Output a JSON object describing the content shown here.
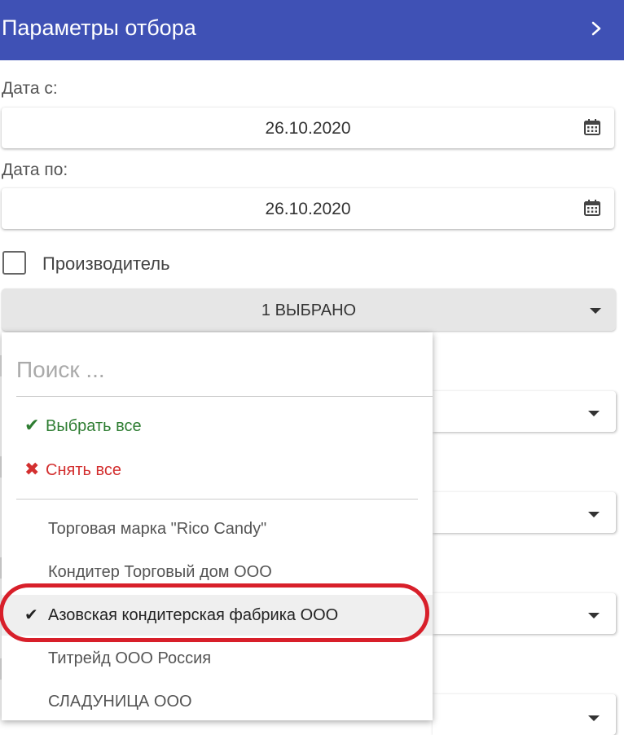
{
  "header": {
    "title": "Параметры отбора",
    "chevron_icon": "chevron-right-icon"
  },
  "date_from": {
    "label": "Дата с:",
    "value": "26.10.2020",
    "icon": "calendar-icon"
  },
  "date_to": {
    "label": "Дата по:",
    "value": "26.10.2020",
    "icon": "calendar-icon"
  },
  "manufacturer": {
    "checkbox_label": "Производитель",
    "checked": false,
    "select_text": "1 ВЫБРАНО"
  },
  "dropdown": {
    "search_placeholder": "Поиск ...",
    "select_all": "Выбрать все",
    "deselect_all": "Снять все",
    "options": [
      {
        "label": "Торговая марка \"Rico Candy\"",
        "selected": false
      },
      {
        "label": "Кондитер Торговый дом ООО",
        "selected": false
      },
      {
        "label": "Азовская кондитерская фабрика ООО",
        "selected": true
      },
      {
        "label": "Титрейд ООО Россия",
        "selected": false
      },
      {
        "label": "СЛАДУНИЦА ООО",
        "selected": false
      }
    ]
  },
  "colors": {
    "header_bg": "#3f51b5",
    "select_all": "#2e7d32",
    "deselect_all": "#d32f2f",
    "highlight": "#d81f2a"
  }
}
